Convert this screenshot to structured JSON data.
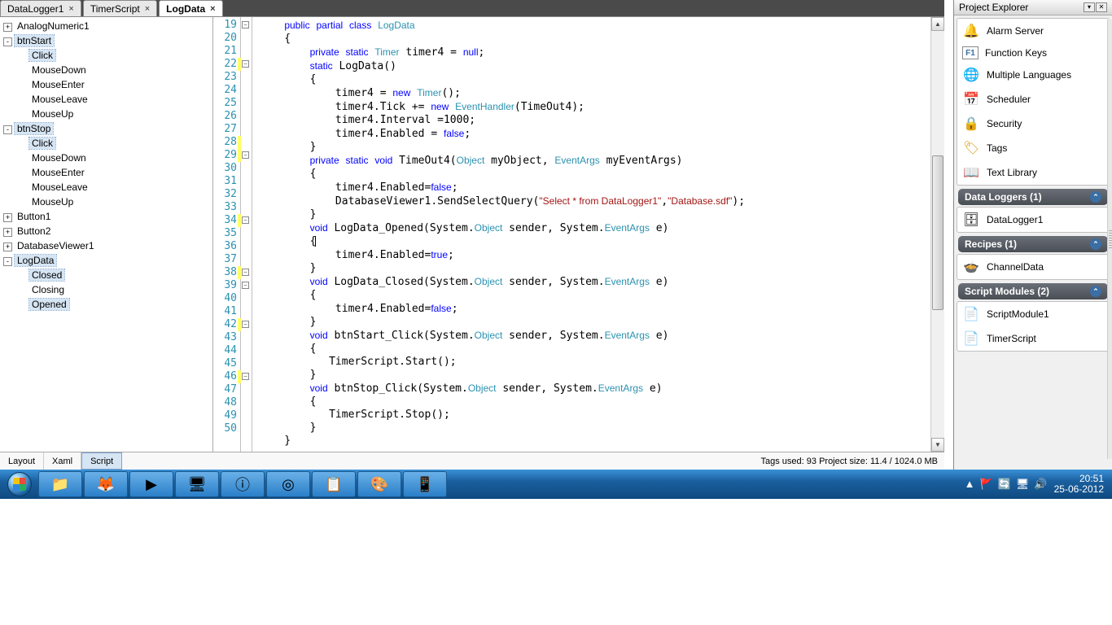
{
  "tabs": [
    {
      "label": "DataLogger1",
      "active": false
    },
    {
      "label": "TimerScript",
      "active": false
    },
    {
      "label": "LogData",
      "active": true
    }
  ],
  "tree": {
    "items": [
      {
        "label": "AnalogNumeric1",
        "exp": "+",
        "children": []
      },
      {
        "label": "btnStart",
        "exp": "-",
        "sel": true,
        "children": [
          {
            "label": "Click",
            "sel": true
          },
          {
            "label": "MouseDown"
          },
          {
            "label": "MouseEnter"
          },
          {
            "label": "MouseLeave"
          },
          {
            "label": "MouseUp"
          }
        ]
      },
      {
        "label": "btnStop",
        "exp": "-",
        "sel": true,
        "children": [
          {
            "label": "Click",
            "sel": true
          },
          {
            "label": "MouseDown"
          },
          {
            "label": "MouseEnter"
          },
          {
            "label": "MouseLeave"
          },
          {
            "label": "MouseUp"
          }
        ]
      },
      {
        "label": "Button1",
        "exp": "+",
        "children": []
      },
      {
        "label": "Button2",
        "exp": "+",
        "children": []
      },
      {
        "label": "DatabaseViewer1",
        "exp": "+",
        "children": []
      },
      {
        "label": "LogData",
        "exp": "-",
        "sel": true,
        "children": [
          {
            "label": "Closed",
            "sel": true
          },
          {
            "label": "Closing"
          },
          {
            "label": "Opened",
            "sel": true
          }
        ]
      }
    ]
  },
  "code": {
    "start": 19,
    "lines": [
      {
        "t": "    <kw>public</kw> <kw>partial</kw> <kw>class</kw> <typ>LogData</typ>",
        "fold": "-"
      },
      {
        "t": "    {"
      },
      {
        "t": "        <kw>private</kw> <kw>static</kw> <typ>Timer</typ> timer4 = <kw>null</kw>;"
      },
      {
        "t": "        <kw>static</kw> LogData()",
        "mark": true,
        "fold": "-"
      },
      {
        "t": "        {"
      },
      {
        "t": "            timer4 = <kw>new</kw> <typ>Timer</typ>();"
      },
      {
        "t": "            timer4.Tick += <kw>new</kw> <typ>EventHandler</typ>(TimeOut4);"
      },
      {
        "t": "            timer4.Interval =1000;"
      },
      {
        "t": "            timer4.Enabled = <kw>false</kw>;"
      },
      {
        "t": "        }",
        "mark": true
      },
      {
        "t": "        <kw>private</kw> <kw>static</kw> <kw>void</kw> TimeOut4(<typ>Object</typ> myObject, <typ>EventArgs</typ> myEventArgs)",
        "mark": true,
        "fold": "-"
      },
      {
        "t": "        {"
      },
      {
        "t": "            timer4.Enabled=<kw>false</kw>;"
      },
      {
        "t": "            DatabaseViewer1.SendSelectQuery(<str>\"Select * from DataLogger1\"</str>,<str>\"Database.sdf\"</str>);"
      },
      {
        "t": "        }"
      },
      {
        "t": "        <kw>void</kw> LogData_Opened(System.<typ>Object</typ> sender, System.<typ>EventArgs</typ> e)",
        "mark": true,
        "fold": "-"
      },
      {
        "t": "        {<caret>"
      },
      {
        "t": "            timer4.Enabled=<kw>true</kw>;"
      },
      {
        "t": "        }"
      },
      {
        "t": "        <kw>void</kw> LogData_Closed(System.<typ>Object</typ> sender, System.<typ>EventArgs</typ> e)",
        "mark": true,
        "fold": "-"
      },
      {
        "t": "        {",
        "fold": "-"
      },
      {
        "t": "            timer4.Enabled=<kw>false</kw>;"
      },
      {
        "t": "        }"
      },
      {
        "t": "        <kw>void</kw> btnStart_Click(System.<typ>Object</typ> sender, System.<typ>EventArgs</typ> e)",
        "mark": true,
        "fold": "-"
      },
      {
        "t": "        {"
      },
      {
        "t": "           TimerScript.Start();"
      },
      {
        "t": "        }"
      },
      {
        "t": "        <kw>void</kw> btnStop_Click(System.<typ>Object</typt> sender, System.<typ>EventArgs</typ> e)",
        "mark": true,
        "fold": "-"
      },
      {
        "t": "        {"
      },
      {
        "t": "           TimerScript.Stop();"
      },
      {
        "t": "        }"
      },
      {
        "t": "    }"
      }
    ]
  },
  "statusbar": {
    "tabs": [
      "Layout",
      "Xaml",
      "Script"
    ],
    "active": 2,
    "status": "Tags used: 93   Project size: 11.4 / 1024.0 MB"
  },
  "panel": {
    "title": "Project Explorer",
    "funcs": [
      {
        "ico": "🔔",
        "label": "Alarm Server",
        "color": "#f4c430"
      },
      {
        "ico": "F1",
        "label": "Function Keys",
        "box": true
      },
      {
        "ico": "🌐",
        "label": "Multiple Languages"
      },
      {
        "ico": "📅",
        "label": "Scheduler"
      },
      {
        "ico": "🔒",
        "label": "Security",
        "color": "#d4a017"
      },
      {
        "ico": "🏷",
        "label": "Tags",
        "color": "#d4a017"
      },
      {
        "ico": "📖",
        "label": "Text Library"
      }
    ],
    "groups": [
      {
        "title": "Data Loggers (1)",
        "items": [
          {
            "ico": "🗄",
            "label": "DataLogger1"
          }
        ]
      },
      {
        "title": "Recipes (1)",
        "items": [
          {
            "ico": "🍲",
            "label": "ChannelData"
          }
        ]
      },
      {
        "title": "Script Modules (2)",
        "items": [
          {
            "ico": "📄",
            "label": "ScriptModule1"
          },
          {
            "ico": "📄",
            "label": "TimerScript"
          }
        ]
      }
    ]
  },
  "taskbar": {
    "buttons": [
      "📁",
      "🦊",
      "▶",
      "🖥",
      "ⓘ",
      "◎",
      "📋",
      "🎨",
      "📱"
    ],
    "tray": [
      "▲",
      "🚩",
      "🔄",
      "🖥",
      "🔊"
    ],
    "time": "20:51",
    "date": "25-06-2012"
  }
}
